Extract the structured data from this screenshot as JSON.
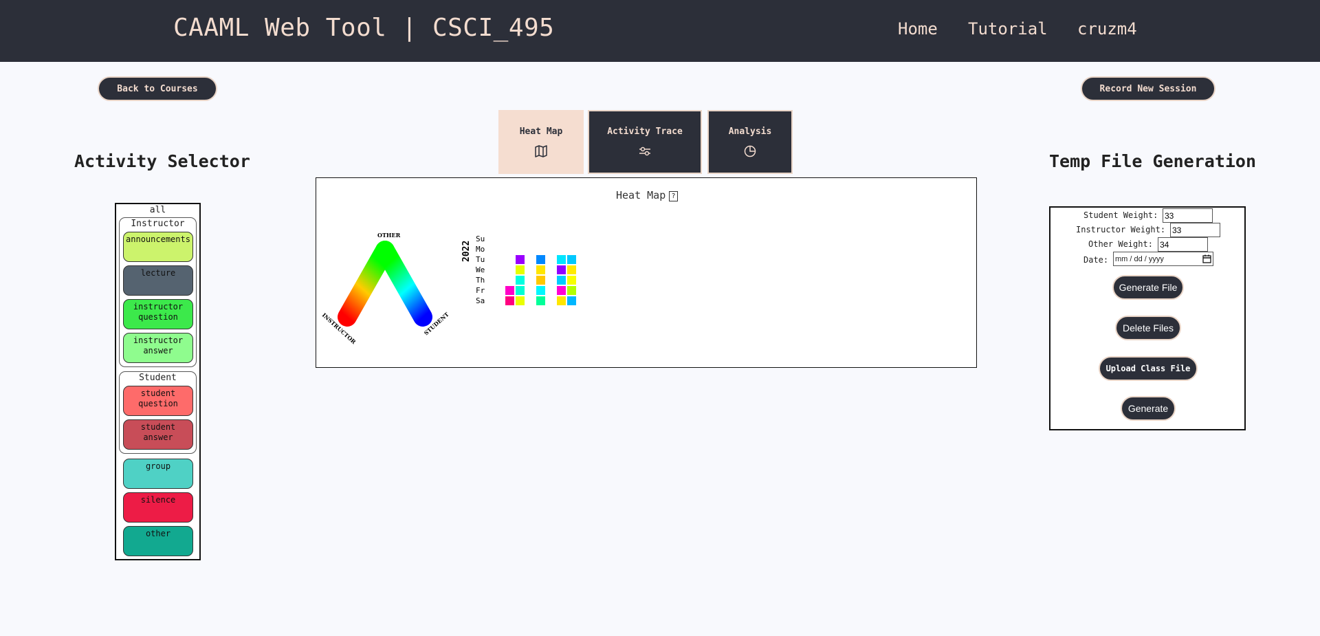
{
  "header": {
    "title": "CAAML Web Tool | CSCI_495",
    "nav": [
      "Home",
      "Tutorial",
      "cruzm4"
    ]
  },
  "buttons": {
    "back": "Back to Courses",
    "record": "Record New Session"
  },
  "tabs": [
    {
      "label": "Heat Map",
      "icon": "map-icon",
      "active": true
    },
    {
      "label": "Activity Trace",
      "icon": "sliders-icon",
      "active": false
    },
    {
      "label": "Analysis",
      "icon": "pie-chart-icon",
      "active": false
    }
  ],
  "activity_selector": {
    "title": "Activity Selector",
    "all_label": "all",
    "instructor": {
      "title": "Instructor",
      "items": [
        {
          "label": "announcements",
          "color": "#ccf36c"
        },
        {
          "label": "lecture",
          "color": "#556370"
        },
        {
          "label": "instructor question",
          "color": "#3ce94b"
        },
        {
          "label": "instructor answer",
          "color": "#8ffc8e"
        }
      ]
    },
    "student": {
      "title": "Student",
      "items": [
        {
          "label": "student question",
          "color": "#fe6b6a"
        },
        {
          "label": "student answer",
          "color": "#c84d58"
        }
      ]
    },
    "other_items": [
      {
        "label": "group",
        "color": "#4fd1c5"
      },
      {
        "label": "silence",
        "color": "#ed1c46"
      },
      {
        "label": "other",
        "color": "#12a990"
      }
    ]
  },
  "heatmap": {
    "title": "Heat Map",
    "help": "?",
    "triangle_labels": {
      "top": "OTHER",
      "left": "INSTRUCTOR",
      "right": "STUDENT"
    },
    "year": "2022",
    "days": [
      "Su",
      "Mo",
      "Tu",
      "We",
      "Th",
      "Fr",
      "Sa"
    ],
    "weeks": [
      [
        "",
        "",
        "",
        "",
        "#ff00c8",
        "#ff0080",
        ""
      ],
      [
        "",
        "#9900ff",
        "#e6ff00",
        "#00ffe1",
        "#00ffd5",
        "#eaff00",
        ""
      ],
      [
        "",
        "",
        "",
        "",
        "",
        "",
        ""
      ],
      [
        "",
        "#0088ff",
        "#ffe600",
        "#ffc800",
        "#00f7ff",
        "#00ff99",
        ""
      ],
      [
        "",
        "",
        "",
        "",
        "",
        "",
        ""
      ],
      [
        "",
        "#00e5ff",
        "#9000ff",
        "#00ccff",
        "#ff00d4",
        "#ffe600",
        ""
      ],
      [
        "",
        "#00c8ff",
        "#ffea00",
        "#f7ff00",
        "#b3ff00",
        "#00b7ff",
        ""
      ]
    ]
  },
  "temp_file": {
    "title": "Temp File Generation",
    "student_weight_label": "Student Weight:",
    "student_weight": "33",
    "instructor_weight_label": "Instructor Weight:",
    "instructor_weight": "33",
    "other_weight_label": "Other Weight:",
    "other_weight": "34",
    "date_label": "Date:",
    "date_placeholder": "mm / dd / yyyy",
    "buttons": [
      "Generate File",
      "Delete Files",
      "Upload Class File",
      "Generate"
    ]
  }
}
